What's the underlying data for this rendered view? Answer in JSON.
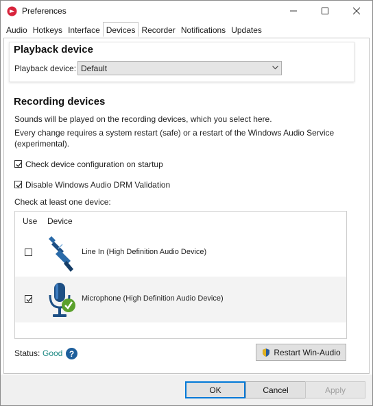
{
  "window": {
    "title": "Preferences",
    "minimize": "minimize",
    "maximize": "maximize",
    "close": "close"
  },
  "tabs": [
    {
      "label": "Audio"
    },
    {
      "label": "Hotkeys"
    },
    {
      "label": "Interface"
    },
    {
      "label": "Devices",
      "active": true
    },
    {
      "label": "Recorder"
    },
    {
      "label": "Notifications"
    },
    {
      "label": "Updates"
    }
  ],
  "playback": {
    "heading": "Playback device",
    "label": "Playback device:",
    "selected": "Default"
  },
  "recording": {
    "heading": "Recording devices",
    "info1": "Sounds will be played on the recording devices, which you select here.",
    "info2a": "Every change requires a system restart (safe) or a restart of the Windows Audio Service",
    "info2b": "(experimental).",
    "check_config": {
      "label": "Check device configuration on startup",
      "checked": true
    },
    "disable_drm": {
      "label": "Disable Windows Audio DRM Validation",
      "checked": true
    },
    "list_caption": "Check at least one device:",
    "columns": {
      "use": "Use",
      "device": "Device"
    },
    "devices": [
      {
        "name": "Line In (High Definition Audio Device)",
        "checked": false,
        "icon": "line-in-jack-icon"
      },
      {
        "name": "Microphone (High Definition Audio Device)",
        "checked": true,
        "icon": "microphone-icon"
      }
    ]
  },
  "status": {
    "label": "Status:",
    "value": "Good",
    "value_color": "#1f8a84",
    "help": "?"
  },
  "restart_button": "Restart Win-Audio",
  "footer": {
    "ok": "OK",
    "cancel": "Cancel",
    "apply": "Apply"
  }
}
